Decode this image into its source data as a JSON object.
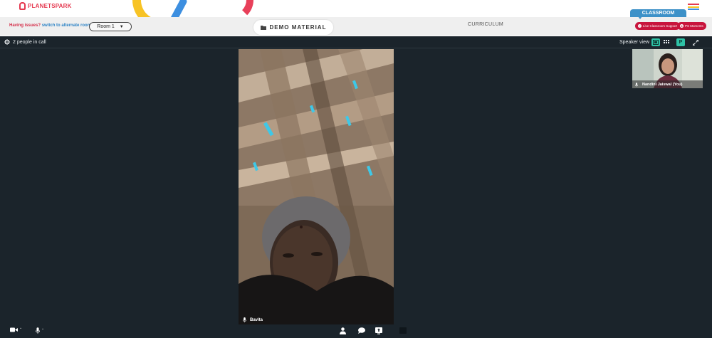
{
  "brand": {
    "name": "PLANETSPARK"
  },
  "toolbar": {
    "issues_prefix": "Having issues?",
    "issues_link": "switch to alternate room",
    "room_value": "Room 1",
    "demo_material": "DEMO MATERIAL",
    "curriculum": "CURRICULUM",
    "classroom_tab": "CLASSROOM",
    "live_support": "Live Classroom Support",
    "ps_moments": "PS Moments"
  },
  "call": {
    "people_count_label": "2 people in call",
    "speaker_view_label": "Speaker view",
    "p_button_label": "P",
    "main_participant": "Bavita",
    "self_participant": "Nandini Jaiswal (You)"
  },
  "colors": {
    "brand_red": "#e53950",
    "link_blue": "#2f84c6",
    "classroom_blue": "#3d91c8",
    "pill_red": "#c8143c",
    "call_bg": "#1b242b",
    "accent_teal": "#2ec2a6"
  },
  "icons": [
    "menu-icon",
    "folder-icon",
    "gear-icon",
    "speaker-view-icon",
    "grid-view-icon",
    "fullscreen-icon",
    "mic-icon",
    "camera-icon",
    "participants-icon",
    "chat-icon",
    "share-screen-icon",
    "whiteboard-icon"
  ]
}
